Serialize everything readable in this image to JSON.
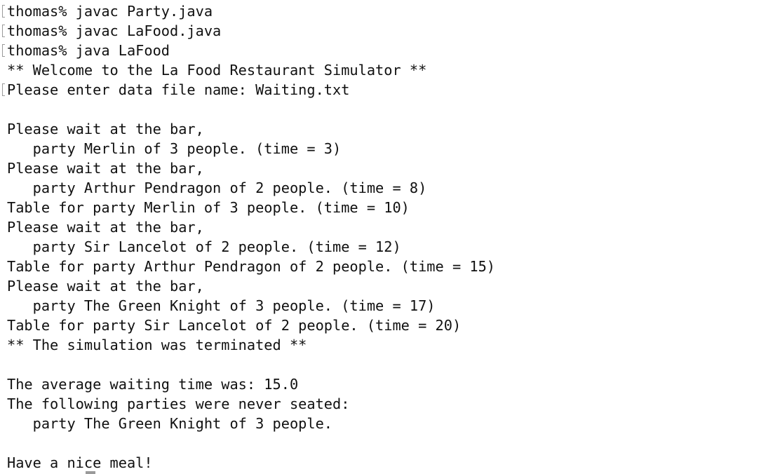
{
  "terminal": {
    "lines": [
      {
        "text": "thomas% javac Party.java",
        "marked": true
      },
      {
        "text": "thomas% javac LaFood.java",
        "marked": true
      },
      {
        "text": "thomas% java LaFood",
        "marked": true
      },
      {
        "text": "** Welcome to the La Food Restaurant Simulator **",
        "marked": false
      },
      {
        "text": "Please enter data file name: Waiting.txt",
        "marked": true
      },
      {
        "text": "",
        "marked": false
      },
      {
        "text": "Please wait at the bar,",
        "marked": false
      },
      {
        "text": "   party Merlin of 3 people. (time = 3)",
        "marked": false
      },
      {
        "text": "Please wait at the bar,",
        "marked": false
      },
      {
        "text": "   party Arthur Pendragon of 2 people. (time = 8)",
        "marked": false
      },
      {
        "text": "Table for party Merlin of 3 people. (time = 10)",
        "marked": false
      },
      {
        "text": "Please wait at the bar,",
        "marked": false
      },
      {
        "text": "   party Sir Lancelot of 2 people. (time = 12)",
        "marked": false
      },
      {
        "text": "Table for party Arthur Pendragon of 2 people. (time = 15)",
        "marked": false
      },
      {
        "text": "Please wait at the bar,",
        "marked": false
      },
      {
        "text": "   party The Green Knight of 3 people. (time = 17)",
        "marked": false
      },
      {
        "text": "Table for party Sir Lancelot of 2 people. (time = 20)",
        "marked": false
      },
      {
        "text": "** The simulation was terminated **",
        "marked": false
      },
      {
        "text": "",
        "marked": false
      },
      {
        "text": "The average waiting time was: 15.0",
        "marked": false
      },
      {
        "text": "The following parties were never seated:",
        "marked": false
      },
      {
        "text": "   party The Green Knight of 3 people.",
        "marked": false
      },
      {
        "text": "",
        "marked": false
      },
      {
        "text": "Have a nice meal!",
        "marked": false
      }
    ]
  }
}
